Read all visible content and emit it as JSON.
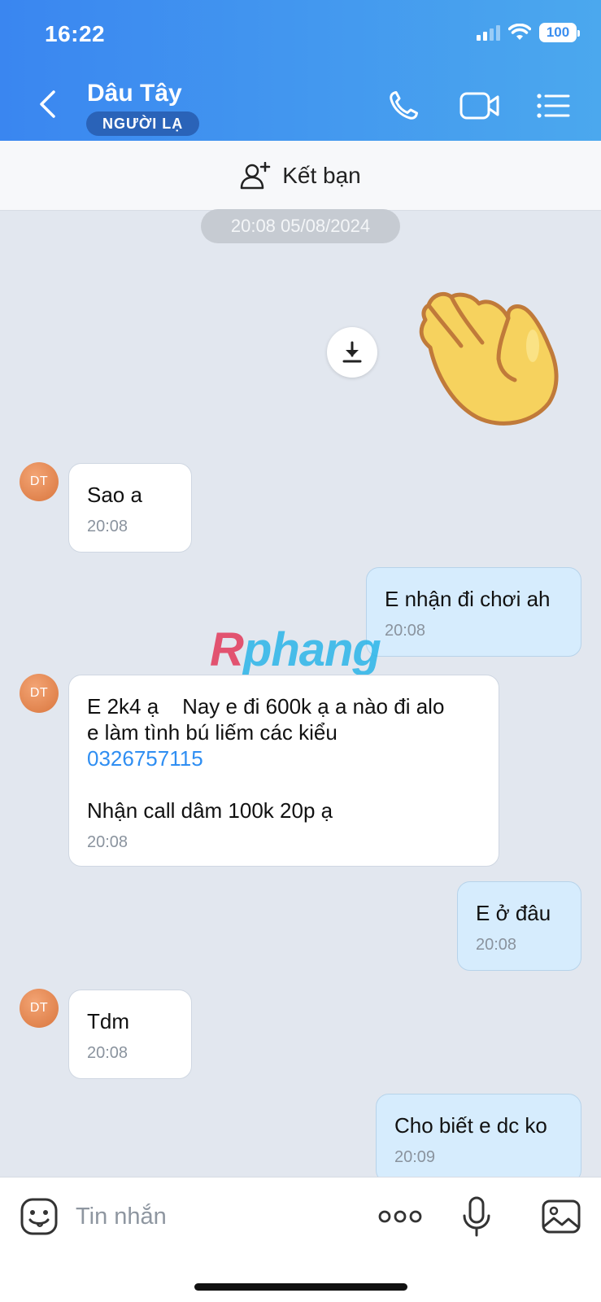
{
  "status_bar": {
    "time": "16:22",
    "battery": "100"
  },
  "header": {
    "contact_name": "Dâu Tây",
    "badge": "NGƯỜI LẠ"
  },
  "add_friend": {
    "label": "Kết bạn"
  },
  "date_separator": "20:08 05/08/2024",
  "colors": {
    "header_start": "#3a86f0",
    "header_end": "#4ba8ee",
    "outgoing_bubble": "#d6ecfd",
    "incoming_bubble": "#ffffff",
    "link": "#2f8ef2"
  },
  "messages": [
    {
      "sender": "them",
      "avatar": "DT",
      "text": "Sao a",
      "time": "20:08"
    },
    {
      "sender": "me",
      "text": "E nhận đi chơi ah",
      "time": "20:08"
    },
    {
      "sender": "them",
      "avatar": "DT",
      "text_line1": "E 2k4 ạ    Nay e đi 600k ạ a nào đi alo",
      "text_line2": "e làm tình bú liếm các kiểu",
      "phone": "0326757115",
      "text_line3": "Nhận call dâm 100k 20p ạ",
      "time": "20:08"
    },
    {
      "sender": "me",
      "text": "E ở đâu",
      "time": "20:08"
    },
    {
      "sender": "them",
      "avatar": "DT",
      "text": "Tdm",
      "time": "20:08"
    },
    {
      "sender": "me",
      "text": "Cho biết e dc ko",
      "time": "20:09"
    }
  ],
  "watermark": {
    "part1": "R",
    "part2": "phang"
  },
  "input": {
    "placeholder": "Tin nhắn"
  }
}
